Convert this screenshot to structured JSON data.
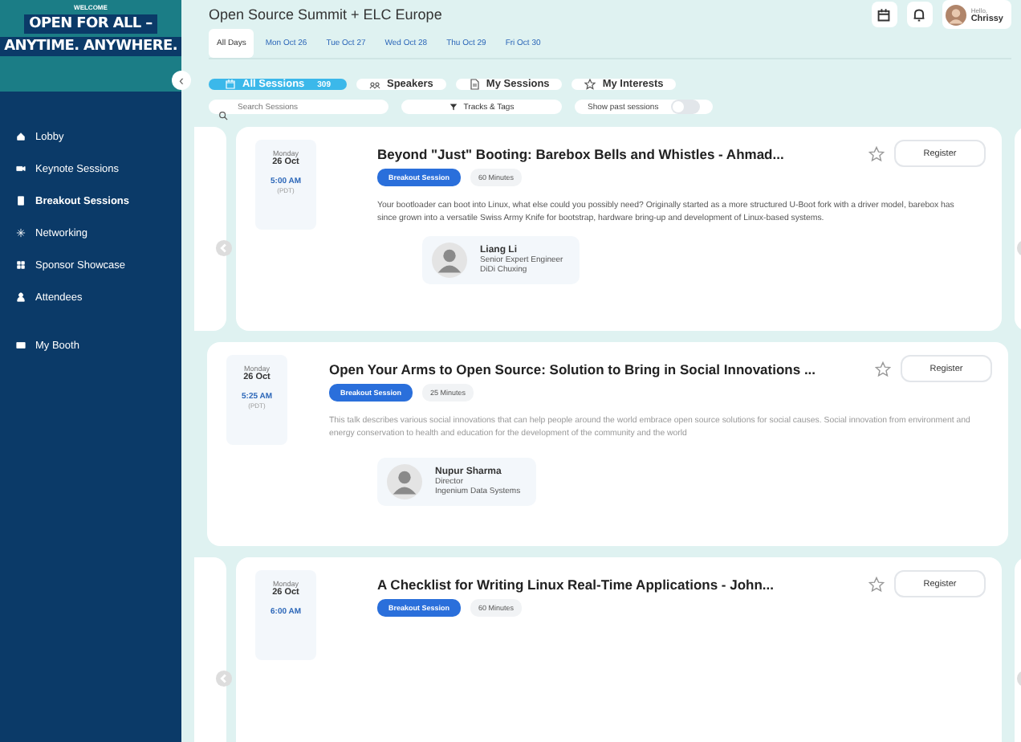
{
  "banner": {
    "welcome": "WELCOME",
    "line1": "OPEN FOR ALL –",
    "line2": "ANYTIME. ANYWHERE.",
    "collapse": "‹"
  },
  "sidebar": {
    "items": [
      {
        "label": "Lobby",
        "selected": false
      },
      {
        "label": "Keynote Sessions",
        "selected": false
      },
      {
        "label": "Breakout Sessions",
        "selected": true
      },
      {
        "label": "Networking",
        "selected": false
      },
      {
        "label": "Sponsor Showcase",
        "selected": false
      },
      {
        "label": "Attendees",
        "selected": false
      },
      {
        "label": "My Booth",
        "selected": false
      }
    ]
  },
  "header": {
    "title": "Open Source Summit + ELC Europe",
    "greeting": "Hello,",
    "user": "Chrissy"
  },
  "day_tabs": [
    {
      "label": "All Days",
      "selected": true
    },
    {
      "label": "Mon Oct 26",
      "selected": false
    },
    {
      "label": "Tue Oct 27",
      "selected": false
    },
    {
      "label": "Wed Oct 28",
      "selected": false
    },
    {
      "label": "Thu Oct 29",
      "selected": false
    },
    {
      "label": "Fri Oct 30",
      "selected": false
    }
  ],
  "view_tabs": [
    {
      "label": "All Sessions",
      "count": "309",
      "selected": true
    },
    {
      "label": "Speakers",
      "selected": false
    },
    {
      "label": "My Sessions",
      "selected": false
    },
    {
      "label": "My Interests",
      "selected": false
    }
  ],
  "filters": {
    "search": {
      "placeholder": "Search Sessions"
    },
    "tracks_button": "Tracks & Tags",
    "show_past": {
      "label": "Show past sessions",
      "on": false
    }
  },
  "sessions": [
    {
      "kind": "carousel",
      "day": "Monday",
      "date": "26 Oct",
      "time": "5:00 AM",
      "tz": "(PDT)",
      "title": "Beyond \"Just\" Booting: Barebox Bells and Whistles - Ahmad...",
      "tag": "Breakout Session",
      "duration": "60 Minutes",
      "starred": false,
      "button": "Register",
      "description": "Your bootloader can boot into Linux, what else could you possibly need? Originally started as a more structured U-Boot fork with a driver model, barebox has since grown into a versatile Swiss Army Knife for bootstrap, hardware bring-up and development of Linux-based systems.",
      "speaker": {
        "name": "Liang Li",
        "role": "Senior Expert Engineer",
        "company": "DiDi Chuxing"
      }
    },
    {
      "kind": "single",
      "day": "Monday",
      "date": "26 Oct",
      "time": "5:25 AM",
      "tz": "(PDT)",
      "title": "Open Your Arms to Open Source: Solution to Bring in Social Innovations ...",
      "tag": "Breakout Session",
      "duration": "25 Minutes",
      "starred": false,
      "button": "Register",
      "description": "This talk describes various social innovations that can help people around the world embrace open source solutions for social causes. Social innovation from environment and energy conservation to health and education for the development of the community and the world",
      "speaker": {
        "name": "Nupur Sharma",
        "role": "Director",
        "company": "Ingenium Data Systems"
      }
    },
    {
      "kind": "carousel",
      "day": "Monday",
      "date": "26 Oct",
      "time": "6:00 AM",
      "title": "A Checklist for Writing Linux Real-Time Applications - John...",
      "tag": "Breakout Session",
      "duration": "60 Minutes",
      "starred": false,
      "button": "Register"
    }
  ]
}
